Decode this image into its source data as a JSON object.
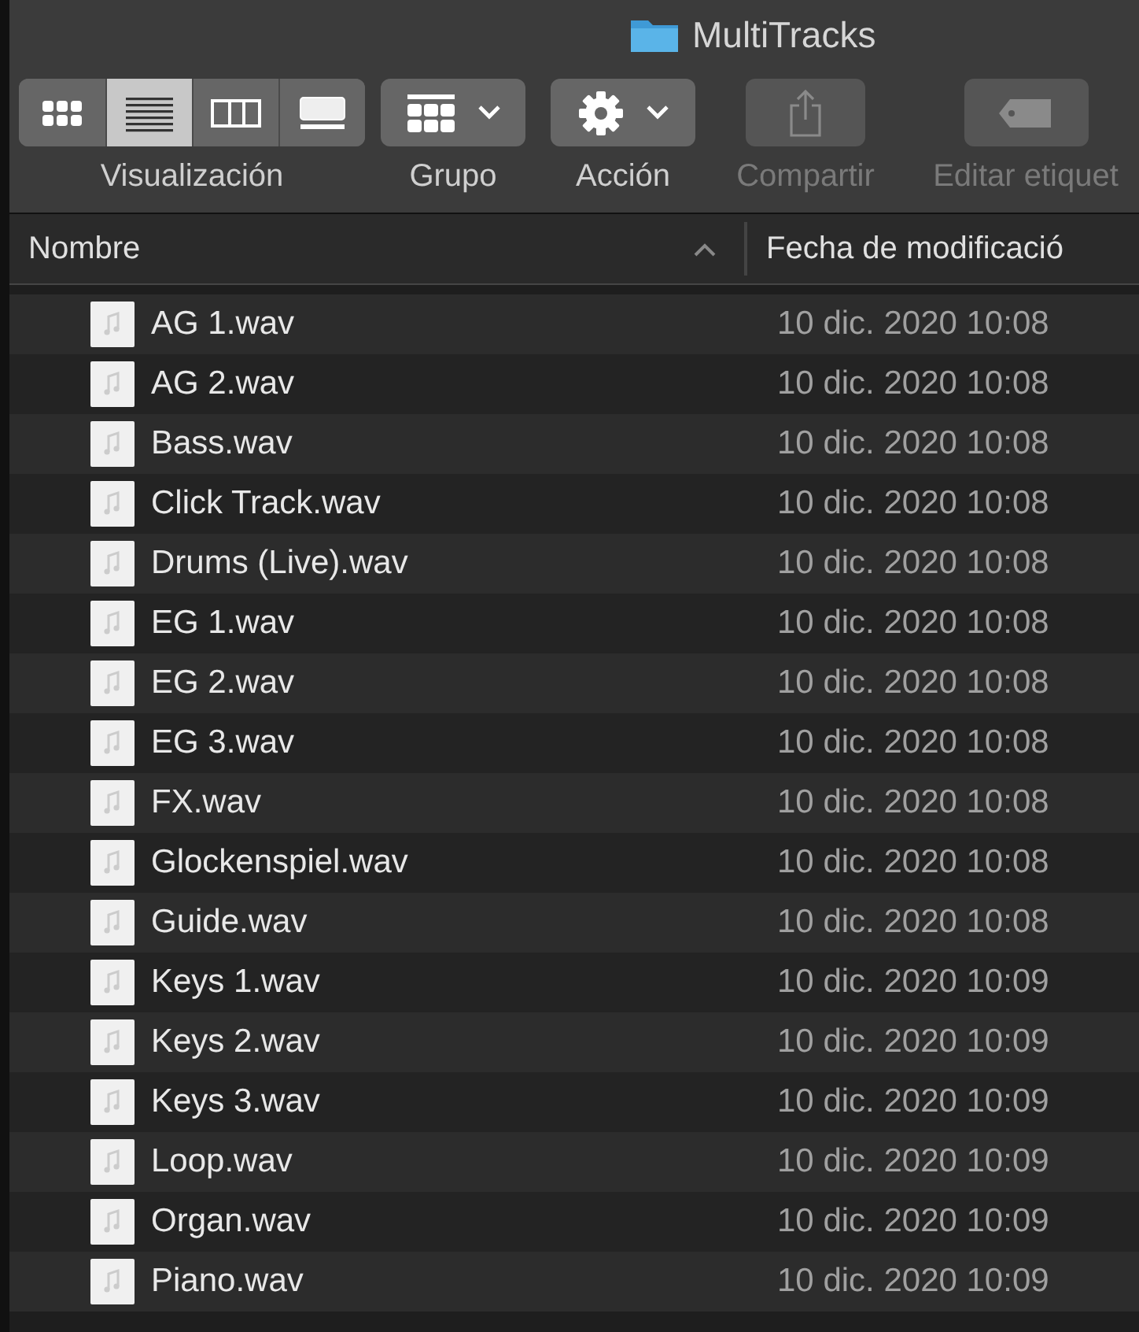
{
  "window": {
    "title": "MultiTracks"
  },
  "toolbar": {
    "view_modes": [
      {
        "kind": "icons",
        "selected": false
      },
      {
        "kind": "list",
        "selected": true
      },
      {
        "kind": "columns",
        "selected": false
      },
      {
        "kind": "gallery",
        "selected": false
      }
    ],
    "view_label": "Visualización",
    "tools": [
      {
        "kind": "group",
        "label": "Grupo",
        "disabled": false
      },
      {
        "kind": "action",
        "label": "Acción",
        "disabled": false
      },
      {
        "kind": "share",
        "label": "Compartir",
        "disabled": true
      },
      {
        "kind": "tag",
        "label": "Editar etiquet",
        "disabled": true
      }
    ]
  },
  "table": {
    "columns": [
      {
        "label": "Nombre",
        "sorted": true
      },
      {
        "label": "Fecha de modificació",
        "sorted": false
      }
    ],
    "rows": [
      {
        "name": "AG 1.wav",
        "date": "10 dic. 2020 10:08"
      },
      {
        "name": "AG 2.wav",
        "date": "10 dic. 2020 10:08"
      },
      {
        "name": "Bass.wav",
        "date": "10 dic. 2020 10:08"
      },
      {
        "name": "Click Track.wav",
        "date": "10 dic. 2020 10:08"
      },
      {
        "name": "Drums (Live).wav",
        "date": "10 dic. 2020 10:08"
      },
      {
        "name": "EG 1.wav",
        "date": "10 dic. 2020 10:08"
      },
      {
        "name": "EG 2.wav",
        "date": "10 dic. 2020 10:08"
      },
      {
        "name": "EG 3.wav",
        "date": "10 dic. 2020 10:08"
      },
      {
        "name": "FX.wav",
        "date": "10 dic. 2020 10:08"
      },
      {
        "name": "Glockenspiel.wav",
        "date": "10 dic. 2020 10:08"
      },
      {
        "name": "Guide.wav",
        "date": "10 dic. 2020 10:08"
      },
      {
        "name": "Keys 1.wav",
        "date": "10 dic. 2020 10:09"
      },
      {
        "name": "Keys 2.wav",
        "date": "10 dic. 2020 10:09"
      },
      {
        "name": "Keys 3.wav",
        "date": "10 dic. 2020 10:09"
      },
      {
        "name": "Loop.wav",
        "date": "10 dic. 2020 10:09"
      },
      {
        "name": "Organ.wav",
        "date": "10 dic. 2020 10:09"
      },
      {
        "name": "Piano.wav",
        "date": "10 dic. 2020 10:09"
      }
    ]
  }
}
